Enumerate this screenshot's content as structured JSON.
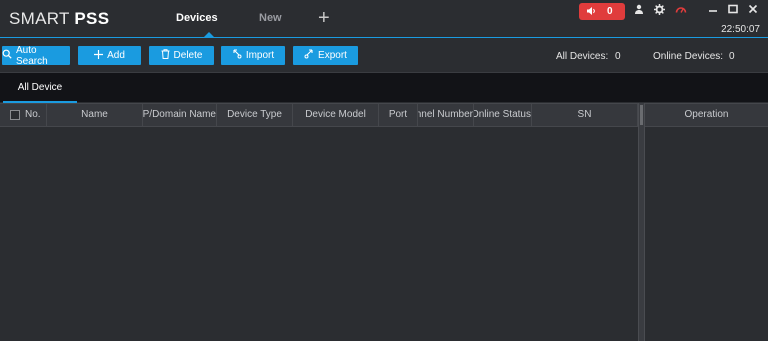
{
  "app": {
    "title_light": "SMART ",
    "title_bold": "PSS"
  },
  "tabs": [
    {
      "label": "Devices",
      "active": true
    },
    {
      "label": "New",
      "active": false
    }
  ],
  "add_tab_glyph": "+",
  "alarm": {
    "count": "0",
    "color": "#e03c3c"
  },
  "clock": "22:50:07",
  "toolbar": {
    "auto_search": "Auto Search",
    "add": "Add",
    "delete": "Delete",
    "import": "Import",
    "export": "Export"
  },
  "stats": {
    "all_devices_label": "All Devices:",
    "all_devices_value": "0",
    "online_devices_label": "Online Devices:",
    "online_devices_value": "0"
  },
  "subtab": "All Device",
  "columns": {
    "no": "No.",
    "name": "Name",
    "ip": "IP/Domain Name",
    "device_type": "Device Type",
    "device_model": "Device Model",
    "port": "Port",
    "channel": "Channel Number",
    "online_status": "Online Status",
    "sn": "SN",
    "operation": "Operation"
  },
  "colors": {
    "accent": "#1a9be0",
    "background": "#2b2d31"
  }
}
